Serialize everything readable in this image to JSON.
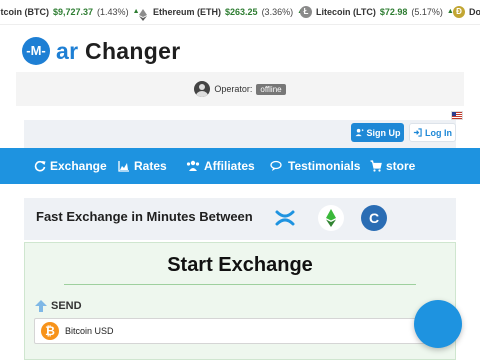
{
  "ticker": [
    {
      "name": "itcoin (BTC)",
      "price": "$9,727.37",
      "change": "(1.43%)",
      "icon": "bitcoin-icon"
    },
    {
      "name": "Ethereum (ETH)",
      "price": "$263.25",
      "change": "(3.36%)",
      "icon": "ethereum-icon"
    },
    {
      "name": "Litecoin (LTC)",
      "price": "$72.98",
      "change": "(5.17%)",
      "icon": "litecoin-icon"
    },
    {
      "name": "Do",
      "price": "",
      "change": "",
      "icon": "dogecoin-icon"
    }
  ],
  "logo": {
    "badge": "-M-",
    "prefix": "ar",
    "suffix": "Changer"
  },
  "operator": {
    "label": "Operator:",
    "status": "offline"
  },
  "auth": {
    "signup": "Sign Up",
    "login": "Log In"
  },
  "nav": [
    {
      "label": "Exchange",
      "icon": "refresh-icon"
    },
    {
      "label": "Rates",
      "icon": "chart-icon"
    },
    {
      "label": "Affiliates",
      "icon": "users-icon"
    },
    {
      "label": "Testimonials",
      "icon": "comments-icon"
    },
    {
      "label": "store",
      "icon": "cart-icon"
    }
  ],
  "fast_exchange": {
    "title": "Fast Exchange in Minutes Between",
    "coins": [
      "xrp-icon",
      "ethereum-classic-icon",
      "c-coin-icon"
    ],
    "c_letter": "C"
  },
  "exchange": {
    "title": "Start Exchange",
    "send_label": "SEND",
    "selected_currency": "Bitcoin USD"
  },
  "colors": {
    "primary": "#1e93e0",
    "price_up": "#2e7d32",
    "bitcoin": "#f7931a"
  }
}
